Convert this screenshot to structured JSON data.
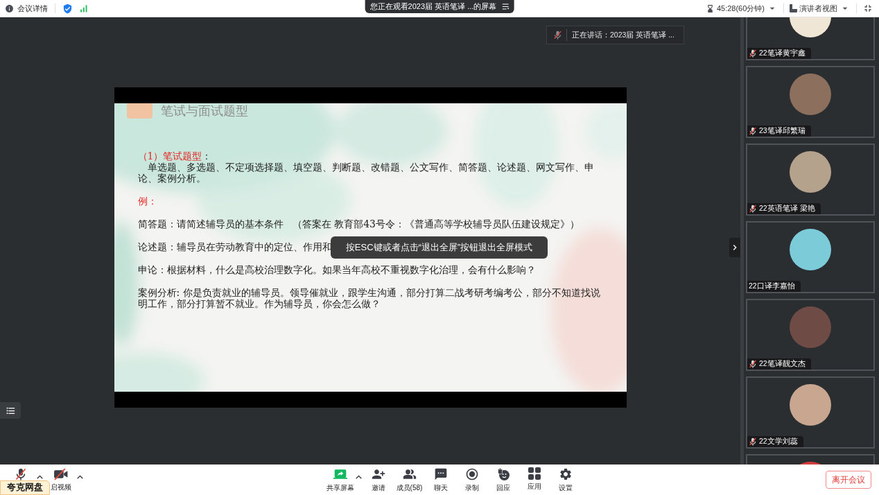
{
  "top_bar": {
    "meeting_info": "会议详情",
    "sharing_notice": "您正在观看2023届 英语笔译 ...的屏幕",
    "timer": "45:28(60分钟)",
    "view_mode": "演讲者视图"
  },
  "stage": {
    "speaking": "正在讲话：2023届 英语笔译 ...",
    "fullscreen_hint": "按ESC键或者点击“退出全屏”按钮退出全屏模式"
  },
  "slide": {
    "title": "笔试与面试题型",
    "sections": [
      {
        "lines": [
          {
            "kind": "heading",
            "indent": false,
            "text": "（1）笔试题型",
            "suffix": "："
          },
          {
            "kind": "body",
            "indent": true,
            "text": "单选题、多选题、不定项选择题、填空题、判断题、改错题、公文写作、简答题、论述题、网文写作、申论、案例分析。"
          }
        ]
      },
      {
        "lines": [
          {
            "kind": "heading",
            "indent": false,
            "text": "例："
          }
        ]
      },
      {
        "lines": [
          {
            "kind": "body",
            "indent": false,
            "text": "简答题：请简述辅导员的基本条件   （答案在 教育部43号令：《普通高等学校辅导员队伍建设规定》）"
          }
        ]
      },
      {
        "lines": [
          {
            "kind": "body",
            "indent": false,
            "text": "论述题：辅导员在劳动教育中的定位、作用和"
          }
        ]
      },
      {
        "lines": [
          {
            "kind": "body",
            "indent": false,
            "text": "申论：根据材料，什么是高校治理数字化。如果当年高校不重视数字化治理，会有什么影响？"
          }
        ]
      },
      {
        "lines": [
          {
            "kind": "body",
            "indent": false,
            "text": "案例分析: 你是负责就业的辅导员。领导催就业，跟学生沟通，部分打算二战考研考编考公，部分不知道找说明工作，部分打算暂不就业。作为辅导员，你会怎么做？"
          }
        ]
      }
    ]
  },
  "sidebar": {
    "participants": [
      {
        "name": "22笔译黄宇鑫",
        "muted": true,
        "color": "#efe6d6"
      },
      {
        "name": "23笔译邱繁瑞",
        "muted": true,
        "color": "#8c6f5c"
      },
      {
        "name": "22英语笔译 梁艳",
        "muted": true,
        "color": "#b5a28c"
      },
      {
        "name": "22口译李嘉怡",
        "muted": false,
        "color": "#7ccbd9"
      },
      {
        "name": "22笔译靓文杰",
        "muted": true,
        "color": "#6e4c45"
      },
      {
        "name": "22文学刘蕊",
        "muted": true,
        "color": "#c8a690"
      },
      {
        "color": "#d43c3c"
      }
    ]
  },
  "toolbar": {
    "left": [
      {
        "kind": "mic",
        "muted": true,
        "menu": true
      },
      {
        "kind": "video",
        "label": "启视频",
        "off": true,
        "menu": true
      }
    ],
    "center": [
      {
        "kind": "share",
        "label": "共享屏幕",
        "menu": true
      },
      {
        "kind": "invite",
        "label": "邀请",
        "menu": false
      },
      {
        "kind": "members",
        "label": "成员(58)",
        "menu": false
      },
      {
        "kind": "chat",
        "label": "聊天",
        "menu": false
      },
      {
        "kind": "record",
        "label": "录制",
        "menu": false
      },
      {
        "kind": "reactions",
        "label": "回应",
        "menu": false
      },
      {
        "kind": "apps",
        "label": "应用",
        "menu": false
      },
      {
        "kind": "settings",
        "label": "设置",
        "menu": false
      }
    ],
    "leave": "离开会议"
  },
  "floating_tab": {
    "text": "夸克网盘"
  }
}
